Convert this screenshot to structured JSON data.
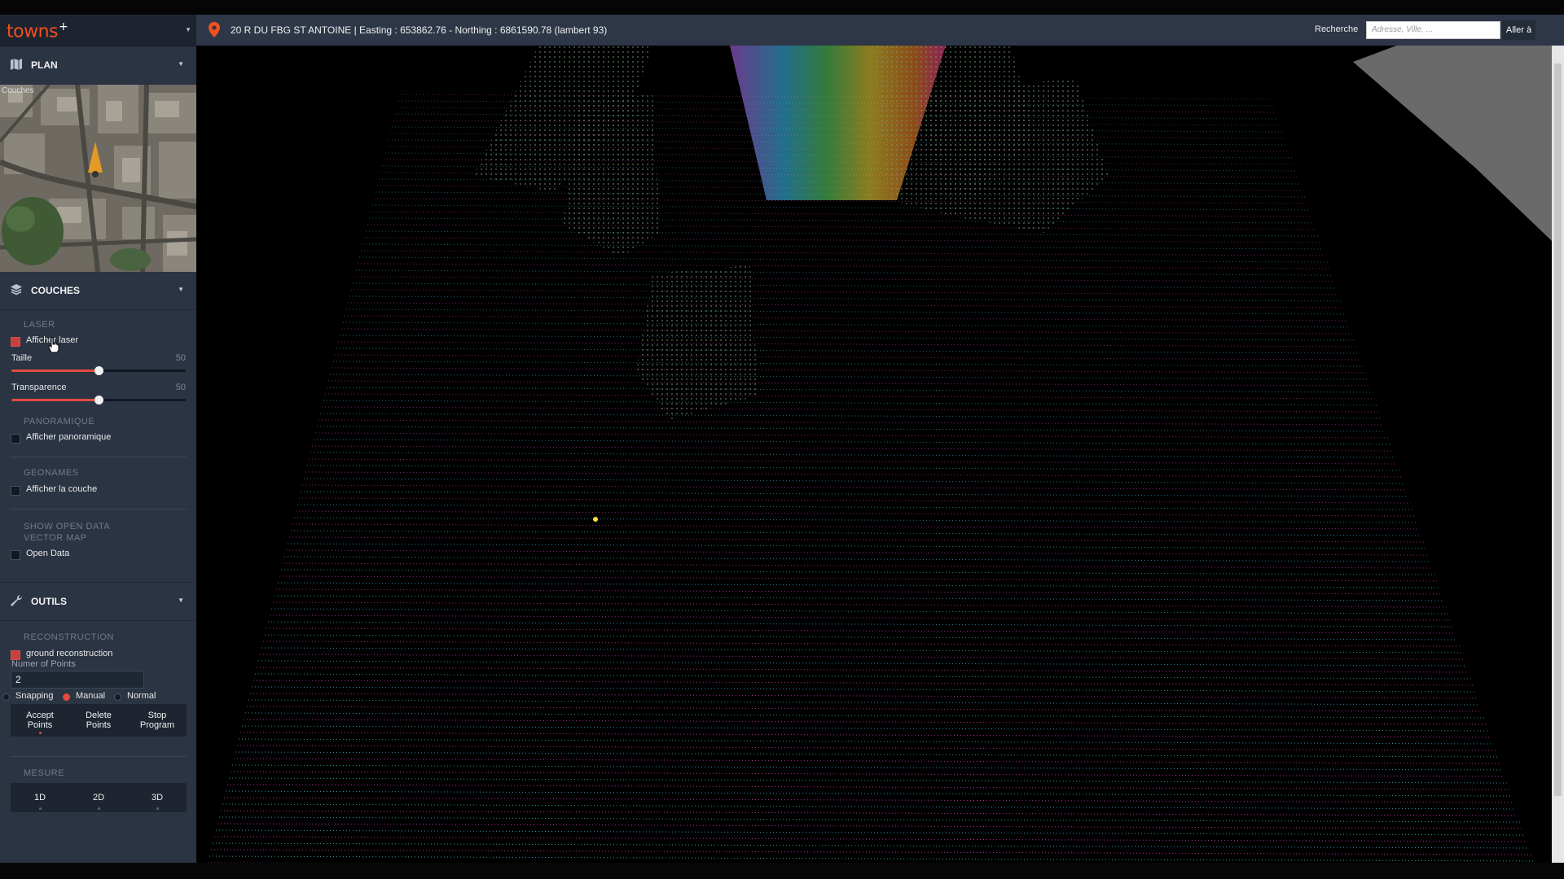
{
  "app": {
    "logo_text": "towns",
    "logo_sup": "+"
  },
  "topbar": {
    "address": "20 R DU FBG ST ANTOINE | Easting : 653862.76 - Northing : 6861590.78 (lambert 93)",
    "search_label": "Recherche",
    "search_placeholder": "Adresse, Ville, ...",
    "goto_label": "Aller à"
  },
  "sidebar": {
    "plan": {
      "title": "PLAN",
      "minimap_label": "Couches"
    },
    "couches": {
      "title": "COUCHES",
      "laser": {
        "group_title": "LASER",
        "show_label": "Afficher laser",
        "show_checked": true,
        "size_label": "Taille",
        "size_value": "50",
        "size_fraction": 0.5,
        "transparency_label": "Transparence",
        "transparency_value": "50",
        "transparency_fraction": 0.5
      },
      "panoramique": {
        "group_title": "PANORAMIQUE",
        "show_label": "Afficher panoramique",
        "checked": false
      },
      "geonames": {
        "group_title": "GEONAMES",
        "show_label": "Afficher la couche",
        "checked": false
      },
      "open_data": {
        "group_title": "SHOW OPEN DATA VECTOR MAP",
        "show_label": "Open Data",
        "checked": false
      }
    },
    "outils": {
      "title": "OUTILS",
      "reconstruction": {
        "group_title": "RECONSTRUCTION",
        "ground_label": "ground reconstruction",
        "ground_checked": true,
        "points_label": "Numer of Points",
        "points_value": "2",
        "mode_options": [
          "Snapping",
          "Manual",
          "Normal"
        ],
        "mode_selected": "Manual",
        "buttons": [
          {
            "line1": "Accept",
            "line2": "Points"
          },
          {
            "line1": "Delete",
            "line2": "Points"
          },
          {
            "line1": "Stop",
            "line2": "Program"
          }
        ]
      },
      "mesure": {
        "group_title": "MESURE",
        "buttons": [
          "1D",
          "2D",
          "3D"
        ]
      }
    }
  },
  "colors": {
    "sidebar_bg": "#2b3443",
    "topbar_bg": "#2e3747",
    "accent": "#e24a3f",
    "logo": "#f0501e",
    "pointcloud": [
      "#ff3fd0",
      "#3fd6e8",
      "#7ee06a",
      "#ffe23a",
      "#ff9a2a",
      "#b476ff"
    ]
  },
  "icons": {
    "plan": "map-icon",
    "couches": "layers-icon",
    "outils": "wrench-icon",
    "address": "location-pin-icon",
    "cursor": "hand-cursor-icon"
  },
  "viewport": {
    "content": "3D lidar point cloud street view"
  }
}
